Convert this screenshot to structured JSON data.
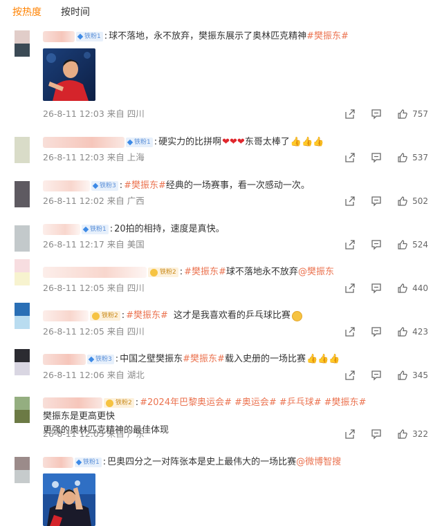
{
  "tabs": [
    {
      "label": "按热度",
      "active": true
    },
    {
      "label": "按时间",
      "active": false
    }
  ],
  "comments": [
    {
      "avatar": [
        "#e1cdc9",
        "#3b4a55"
      ],
      "badge": "铁粉1",
      "text1": "球不落地，永不放弃，樊振东展示了奥林匹克精神",
      "tag1": "#樊振东#",
      "time": "26-8-11 12:03",
      "location": "来自 四川",
      "likes": "757"
    },
    {
      "avatar": [
        "#d9dcc8",
        "#d9dcc8"
      ],
      "badge": "铁粉1",
      "text1": "硬实力的比拼啊",
      "text2": "东哥太棒了",
      "time": "26-8-11 12:03",
      "location": "来自 上海",
      "likes": "537"
    },
    {
      "avatar": [
        "#5e5a61",
        "#5e5a61"
      ],
      "badge": "铁粉3",
      "tag1": "#樊振东#",
      "text1": " 经典的一场赛事，看一次感动一次。",
      "time": "26-8-11 12:02",
      "location": "来自 广西",
      "likes": "502"
    },
    {
      "avatar": [
        "#c3c9cb",
        "#c3c9cb"
      ],
      "badge": "铁粉1",
      "text1": "20拍的相持，速度是真快。",
      "time": "26-8-11 12:17",
      "location": "来自 美国",
      "likes": "524"
    },
    {
      "avatar": [
        "#f7dde0",
        "#f7f3cf"
      ],
      "badge": "铁粉2",
      "tag1": "#樊振东#",
      "text1": " 球不落地永不放弃",
      "mention": "@樊振东",
      "time": "26-8-11 12:05",
      "location": "来自 四川",
      "likes": "440"
    },
    {
      "avatar": [
        "#2a6fb5",
        "#b9dcf0"
      ],
      "badge": "铁粉2",
      "tag1": "#樊振东#",
      "text1": "这才是我喜欢看的乒乓球比赛",
      "time": "26-8-11 12:05",
      "location": "来自 四川",
      "likes": "423"
    },
    {
      "avatar": [
        "#2b2b31",
        "#d9d6e2"
      ],
      "badge": "铁粉3",
      "text1": "中国之壁樊振东",
      "tag1": "#樊振东#",
      "text2": "载入史册的一场比赛",
      "time": "26-8-11 12:06",
      "location": "来自 湖北",
      "likes": "345"
    },
    {
      "avatar": [
        "#94ae80",
        "#6c7a45"
      ],
      "badge": "铁粉2",
      "tag1": "#2024年巴黎奥运会#",
      "tag2": "#奥运会#",
      "tag3": "#乒乓球#",
      "tag4": "#樊振东#",
      "text1": " 樊振东是更高更快",
      "text2": "更强的奥林匹克精神的最佳体现",
      "time": "26-8-11 12:05",
      "location": "来自 广东",
      "likes": "322"
    },
    {
      "avatar": [
        "#9b8b8a",
        "#c6cbcc"
      ],
      "badge": "铁粉1",
      "text1": "巴奥四分之一对阵张本是史上最伟大的一场比赛",
      "mention": "@微博智搜"
    }
  ],
  "colors": {
    "accent": "#ff8200",
    "tag": "#eb7350",
    "meta": "#8a8a8a"
  },
  "icons": [
    "share-icon",
    "comment-icon",
    "like-icon"
  ]
}
